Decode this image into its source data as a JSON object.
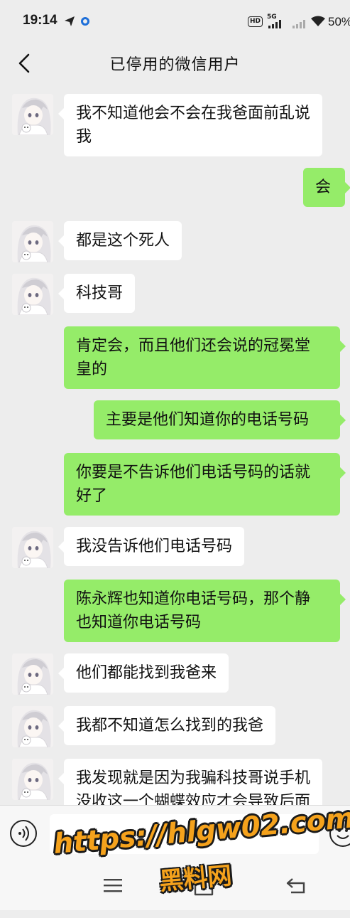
{
  "status_bar": {
    "time": "19:14",
    "hd_label": "HD",
    "network_label": "5G",
    "battery": "50%",
    "icons": [
      "send-icon",
      "location-dot-icon",
      "hd-icon",
      "signal-icon",
      "wifi-icon"
    ]
  },
  "header": {
    "title": "已停用的微信用户",
    "back_icon": "chevron-left-icon"
  },
  "messages": [
    {
      "side": "in",
      "text": "我不知道他会不会在我爸面前乱说\n我"
    },
    {
      "side": "out",
      "text": "会"
    },
    {
      "side": "in",
      "text": "都是这个死人"
    },
    {
      "side": "in",
      "text": "科技哥"
    },
    {
      "side": "out",
      "text": "肯定会，而且他们还会说的冠冕堂\n皇的"
    },
    {
      "side": "out",
      "text": "主要是他们知道你的电话号码"
    },
    {
      "side": "out",
      "text": "你要是不告诉他们电话号码的话就\n好了"
    },
    {
      "side": "in",
      "text": "我没告诉他们电话号码"
    },
    {
      "side": "out",
      "text": "陈永辉也知道你电话号码，那个静\n也知道你电话号码"
    },
    {
      "side": "in",
      "text": "他们都能找到我爸来"
    },
    {
      "side": "in",
      "text": "我都不知道怎么找到的我爸"
    },
    {
      "side": "in",
      "text": "我发现就是因为我骗科技哥说手机\n没收这一个蝴蝶效应才会导致后面"
    }
  ],
  "input_bar": {
    "value": "",
    "voice_icon": "voice-icon",
    "emoji_icon": "emoji-icon"
  },
  "nav_bar": {
    "icons": [
      "menu-icon",
      "home-icon",
      "back-icon"
    ]
  },
  "watermark": {
    "url": "https://hlgw02.com",
    "name": "黑料网"
  },
  "colors": {
    "background": "#ededed",
    "incoming_bubble": "#ffffff",
    "outgoing_bubble": "#95ec69",
    "watermark": "#f5a21c"
  }
}
